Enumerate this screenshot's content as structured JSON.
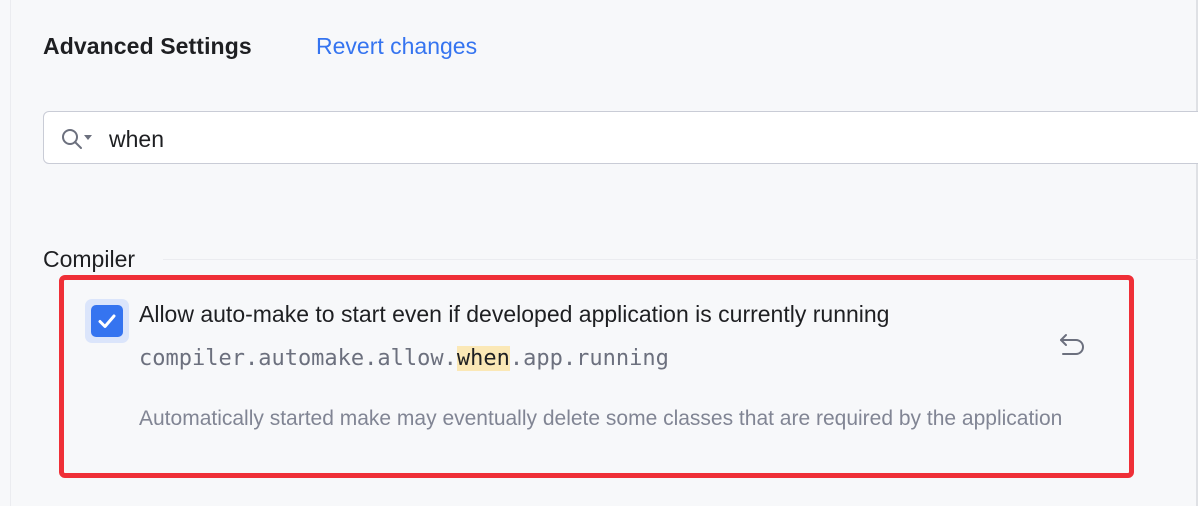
{
  "header": {
    "title": "Advanced Settings",
    "revert_label": "Revert changes"
  },
  "search": {
    "value": "when",
    "icon": "search-with-options-icon"
  },
  "group": {
    "label": "Compiler"
  },
  "option": {
    "checked": true,
    "label": "Allow auto-make to start even if developed application is currently running",
    "key_prefix": "compiler.automake.allow.",
    "key_match": "when",
    "key_suffix": ".app.running",
    "description": "Automatically started make may eventually delete some classes that are required by the application",
    "reset_icon": "undo-icon"
  },
  "colors": {
    "accent": "#3574f0",
    "highlight_outline": "#ef2f37",
    "search_match": "#fbe8b6"
  }
}
